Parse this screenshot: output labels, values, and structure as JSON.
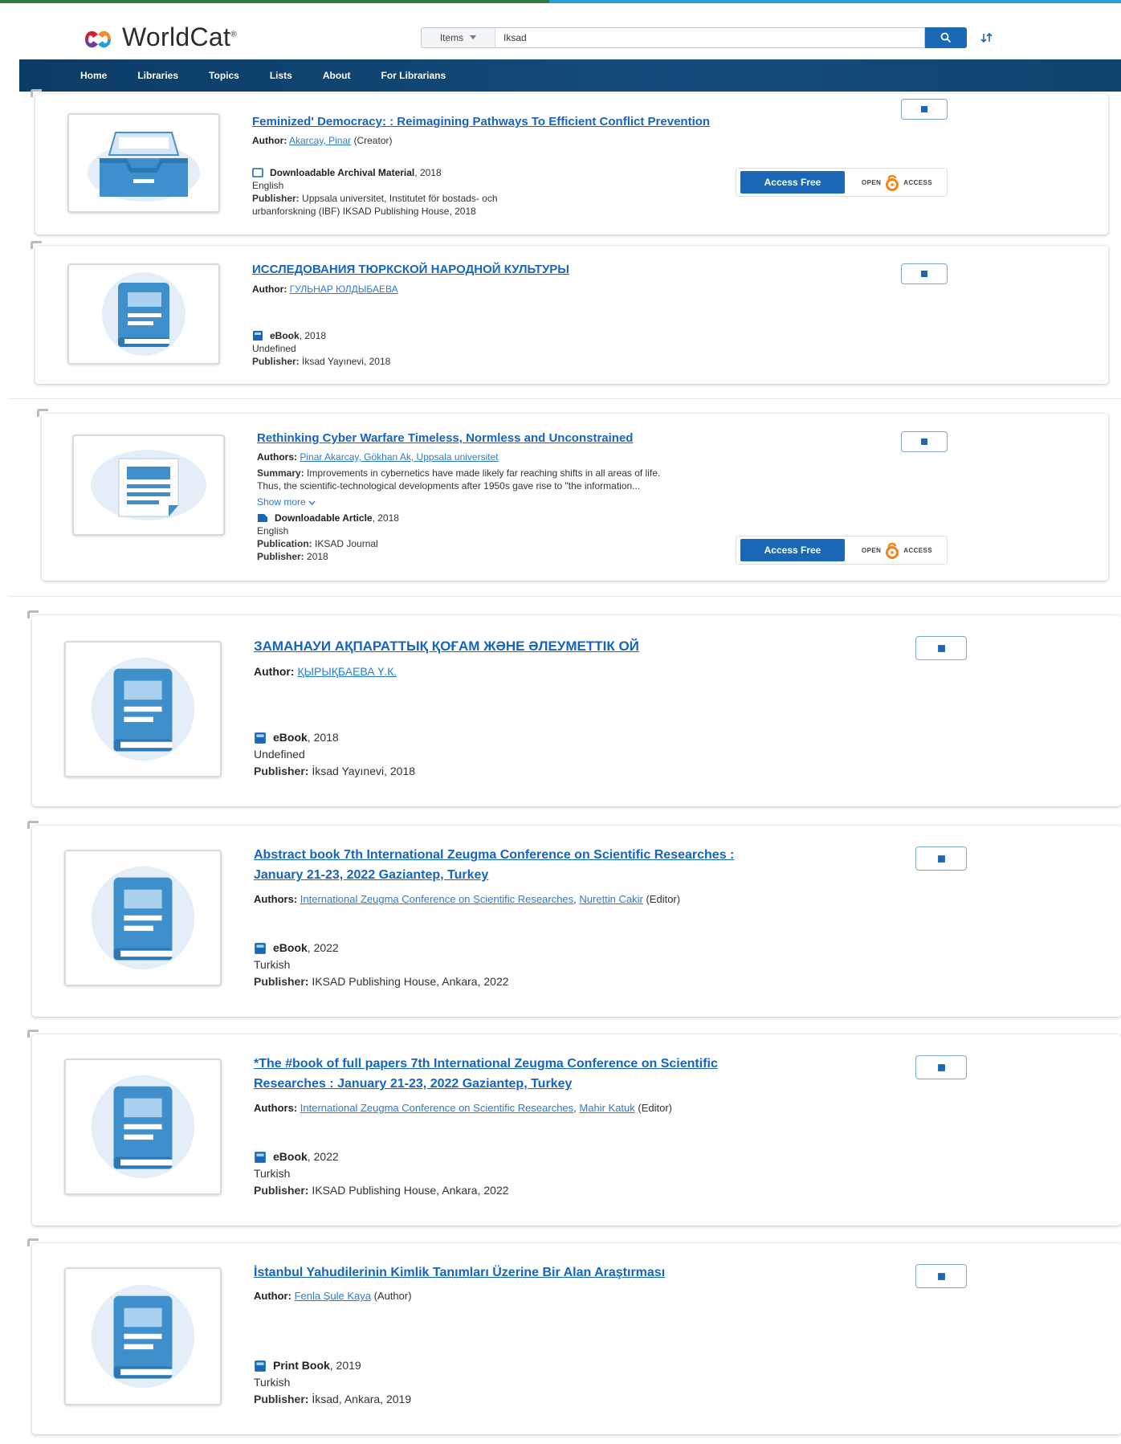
{
  "header": {
    "logo_text": "WorldCat",
    "logo_tm": "®",
    "search_type": "Items",
    "search_value": "Iksad"
  },
  "nav": [
    "Home",
    "Libraries",
    "Topics",
    "Lists",
    "About",
    "For Librarians"
  ],
  "colors": {
    "brand_blue": "#1a68b5",
    "nav_bg": "#0b3c66",
    "link": "#1565c0",
    "accent_green": "#2f7d3a",
    "accent_blue": "#2a9ed6"
  },
  "results": [
    {
      "title": "Feminized' Democracy: : Reimagining Pathways To Efficient Conflict Prevention",
      "author_label": "Author:",
      "author_link": "Akarcay, Pinar",
      "author_role": " (Creator)",
      "format": "Downloadable Archival Material",
      "year": ", 2018",
      "language": "English",
      "publisher_label": "Publisher:",
      "publisher_line1": "Uppsala universitet, Institutet för bostads- och",
      "publisher_line2": "urbanforskning (IBF) IKSAD Publishing House, 2018",
      "access": "Access Free",
      "oa_left": "OPEN",
      "oa_right": "ACCESS",
      "icon": "archive-icon"
    },
    {
      "title": "ИССЛЕДОВАНИЯ ТЮРКСКОЙ НАРОДНОЙ КУЛЬТУРЫ",
      "author_label": "Author:",
      "author_link": "ГУЛЬНАР ЮЛДЫБАЕВА",
      "format": "eBook",
      "year": ", 2018",
      "language": "Undefined",
      "publisher_label": "Publisher:",
      "publisher": "İksad Yayınevi, 2018",
      "icon": "book-icon"
    },
    {
      "title": "Rethinking Cyber Warfare Timeless, Normless and Unconstrained",
      "author_label": "Authors:",
      "author_link": "Pinar Akarcay, Gökhan Ak, Uppsala universitet",
      "summary_label": "Summary:",
      "summary_line1": "Improvements in cybernetics have made likely far reaching shifts in all areas of life.",
      "summary_line2": "Thus, the scientific-technological developments after 1950s gave rise to \"the information...",
      "show_more": "Show more",
      "format": "Downloadable Article",
      "year": ", 2018",
      "language": "English",
      "publication_label": "Publication:",
      "publication": "IKSAD Journal",
      "publisher_label": "Publisher:",
      "publisher": "2018",
      "access": "Access Free",
      "oa_left": "OPEN",
      "oa_right": "ACCESS",
      "icon": "article-icon"
    },
    {
      "title": "ЗАМАНАУИ АҚПАРАТТЫҚ ҚОҒАМ ЖӘНЕ ӘЛЕУМЕТТІК ОЙ",
      "author_label": "Author:",
      "author_link": "ҚЫРЫҚБАЕВА Ү.К.",
      "format": "eBook",
      "year": ", 2018",
      "language": "Undefined",
      "publisher_label": "Publisher:",
      "publisher": "İksad Yayınevi, 2018",
      "icon": "book-icon"
    },
    {
      "title_line1": "Abstract book 7th International Zeugma Conference on Scientific Researches :",
      "title_line2": "January 21-23, 2022 Gaziantep, Turkey",
      "author_label": "Authors:",
      "author_link1": "International Zeugma Conference on Scientific Researches",
      "author_sep": ", ",
      "author_link2": "Nurettin Cakir",
      "author_role": " (Editor)",
      "format": "eBook",
      "year": ", 2022",
      "language": "Turkish",
      "publisher_label": "Publisher:",
      "publisher": "IKSAD Publishing House, Ankara, 2022",
      "icon": "book-icon"
    },
    {
      "title_line1": "*The #book of full papers 7th International Zeugma Conference on Scientific",
      "title_line2": "Researches : January 21-23, 2022 Gaziantep, Turkey",
      "author_label": "Authors:",
      "author_link1": "International Zeugma Conference on Scientific Researches",
      "author_sep": ", ",
      "author_link2": "Mahir Katuk",
      "author_role": " (Editor)",
      "format": "eBook",
      "year": ", 2022",
      "language": "Turkish",
      "publisher_label": "Publisher:",
      "publisher": "IKSAD Publishing House, Ankara, 2022",
      "icon": "book-icon"
    },
    {
      "title": "İstanbul Yahudilerinin Kimlik Tanımları Üzerine Bir Alan Araştırması",
      "author_label": "Author:",
      "author_link": "Fenla Şule Kaya",
      "author_role": " (Author)",
      "format": "Print Book",
      "year": ", 2019",
      "language": "Turkish",
      "publisher_label": "Publisher:",
      "publisher": "İksad, Ankara, 2019",
      "icon": "book-icon"
    }
  ]
}
